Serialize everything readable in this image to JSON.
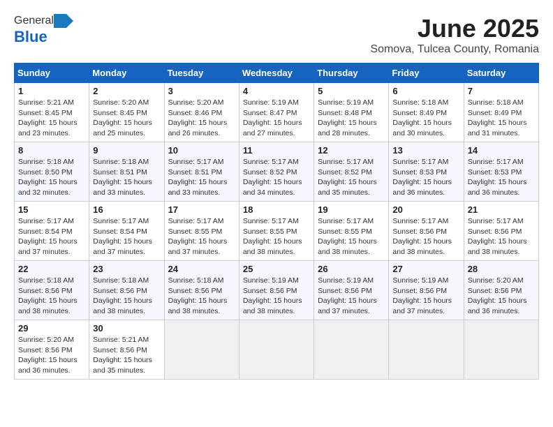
{
  "header": {
    "logo_general": "General",
    "logo_blue": "Blue",
    "title": "June 2025",
    "subtitle": "Somova, Tulcea County, Romania"
  },
  "calendar": {
    "columns": [
      "Sunday",
      "Monday",
      "Tuesday",
      "Wednesday",
      "Thursday",
      "Friday",
      "Saturday"
    ],
    "weeks": [
      [
        {
          "day": "1",
          "sunrise": "5:21 AM",
          "sunset": "8:45 PM",
          "daylight": "15 hours and 23 minutes."
        },
        {
          "day": "2",
          "sunrise": "5:20 AM",
          "sunset": "8:45 PM",
          "daylight": "15 hours and 25 minutes."
        },
        {
          "day": "3",
          "sunrise": "5:20 AM",
          "sunset": "8:46 PM",
          "daylight": "15 hours and 26 minutes."
        },
        {
          "day": "4",
          "sunrise": "5:19 AM",
          "sunset": "8:47 PM",
          "daylight": "15 hours and 27 minutes."
        },
        {
          "day": "5",
          "sunrise": "5:19 AM",
          "sunset": "8:48 PM",
          "daylight": "15 hours and 28 minutes."
        },
        {
          "day": "6",
          "sunrise": "5:18 AM",
          "sunset": "8:49 PM",
          "daylight": "15 hours and 30 minutes."
        },
        {
          "day": "7",
          "sunrise": "5:18 AM",
          "sunset": "8:49 PM",
          "daylight": "15 hours and 31 minutes."
        }
      ],
      [
        {
          "day": "8",
          "sunrise": "5:18 AM",
          "sunset": "8:50 PM",
          "daylight": "15 hours and 32 minutes."
        },
        {
          "day": "9",
          "sunrise": "5:18 AM",
          "sunset": "8:51 PM",
          "daylight": "15 hours and 33 minutes."
        },
        {
          "day": "10",
          "sunrise": "5:17 AM",
          "sunset": "8:51 PM",
          "daylight": "15 hours and 33 minutes."
        },
        {
          "day": "11",
          "sunrise": "5:17 AM",
          "sunset": "8:52 PM",
          "daylight": "15 hours and 34 minutes."
        },
        {
          "day": "12",
          "sunrise": "5:17 AM",
          "sunset": "8:52 PM",
          "daylight": "15 hours and 35 minutes."
        },
        {
          "day": "13",
          "sunrise": "5:17 AM",
          "sunset": "8:53 PM",
          "daylight": "15 hours and 36 minutes."
        },
        {
          "day": "14",
          "sunrise": "5:17 AM",
          "sunset": "8:53 PM",
          "daylight": "15 hours and 36 minutes."
        }
      ],
      [
        {
          "day": "15",
          "sunrise": "5:17 AM",
          "sunset": "8:54 PM",
          "daylight": "15 hours and 37 minutes."
        },
        {
          "day": "16",
          "sunrise": "5:17 AM",
          "sunset": "8:54 PM",
          "daylight": "15 hours and 37 minutes."
        },
        {
          "day": "17",
          "sunrise": "5:17 AM",
          "sunset": "8:55 PM",
          "daylight": "15 hours and 37 minutes."
        },
        {
          "day": "18",
          "sunrise": "5:17 AM",
          "sunset": "8:55 PM",
          "daylight": "15 hours and 38 minutes."
        },
        {
          "day": "19",
          "sunrise": "5:17 AM",
          "sunset": "8:55 PM",
          "daylight": "15 hours and 38 minutes."
        },
        {
          "day": "20",
          "sunrise": "5:17 AM",
          "sunset": "8:56 PM",
          "daylight": "15 hours and 38 minutes."
        },
        {
          "day": "21",
          "sunrise": "5:17 AM",
          "sunset": "8:56 PM",
          "daylight": "15 hours and 38 minutes."
        }
      ],
      [
        {
          "day": "22",
          "sunrise": "5:18 AM",
          "sunset": "8:56 PM",
          "daylight": "15 hours and 38 minutes."
        },
        {
          "day": "23",
          "sunrise": "5:18 AM",
          "sunset": "8:56 PM",
          "daylight": "15 hours and 38 minutes."
        },
        {
          "day": "24",
          "sunrise": "5:18 AM",
          "sunset": "8:56 PM",
          "daylight": "15 hours and 38 minutes."
        },
        {
          "day": "25",
          "sunrise": "5:19 AM",
          "sunset": "8:56 PM",
          "daylight": "15 hours and 38 minutes."
        },
        {
          "day": "26",
          "sunrise": "5:19 AM",
          "sunset": "8:56 PM",
          "daylight": "15 hours and 37 minutes."
        },
        {
          "day": "27",
          "sunrise": "5:19 AM",
          "sunset": "8:56 PM",
          "daylight": "15 hours and 37 minutes."
        },
        {
          "day": "28",
          "sunrise": "5:20 AM",
          "sunset": "8:56 PM",
          "daylight": "15 hours and 36 minutes."
        }
      ],
      [
        {
          "day": "29",
          "sunrise": "5:20 AM",
          "sunset": "8:56 PM",
          "daylight": "15 hours and 36 minutes."
        },
        {
          "day": "30",
          "sunrise": "5:21 AM",
          "sunset": "8:56 PM",
          "daylight": "15 hours and 35 minutes."
        },
        null,
        null,
        null,
        null,
        null
      ]
    ]
  }
}
